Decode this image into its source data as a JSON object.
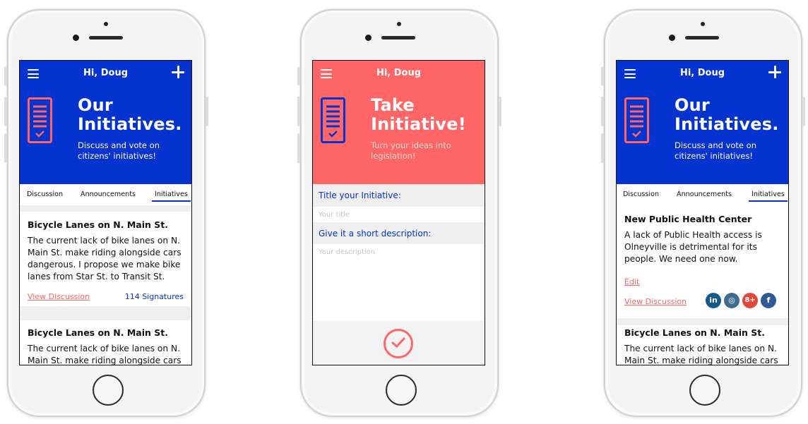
{
  "colors": {
    "brand_blue": "#0433cf",
    "coral": "#ff6665",
    "light_gray": "#efefef"
  },
  "screen1": {
    "greeting": "Hi, Doug",
    "hero_title_line1": "Our",
    "hero_title_line2": "Initiatives.",
    "hero_subtitle": "Discuss and vote on citizens' initiatives!",
    "tabs": [
      "Discussion",
      "Announcements",
      "Initiatives"
    ],
    "active_tab": "Initiatives",
    "cards": [
      {
        "title": "Bicycle Lanes on N. Main St.",
        "body": "The current lack of bike lanes on N. Main St. make riding alongside cars dangerous. I propose we make bike lanes from Star St. to Transit St.",
        "link": "View Discussion",
        "signatures": "114 Signatures"
      },
      {
        "title": "Bicycle Lanes on N. Main St.",
        "body": "The current lack of bike lanes on N. Main St. make riding alongside cars"
      }
    ]
  },
  "screen2": {
    "greeting": "Hi, Doug",
    "hero_title_line1": "Take",
    "hero_title_line2": "Initiative!",
    "hero_subtitle": "Turn your ideas into legislation!",
    "title_label": "Title your Initiative:",
    "title_placeholder": "Your title",
    "desc_label": "Give it a short description:",
    "desc_placeholder": "Your description"
  },
  "screen3": {
    "greeting": "Hi, Doug",
    "hero_title_line1": "Our",
    "hero_title_line2": "Initiatives.",
    "hero_subtitle": "Discuss and vote on citizens' initiatives!",
    "tabs": [
      "Discussion",
      "Announcements",
      "Initiatives"
    ],
    "active_tab": "Initiatives",
    "cards": [
      {
        "title": "New Public Health Center",
        "body": "A lack of Public Health access is Olneyville is detrimental for its people. We need one now.",
        "edit": "Edit",
        "link": "View Discussion",
        "social": [
          {
            "icon": "linkedin-icon",
            "glyph": "in",
            "color": "#155a8f"
          },
          {
            "icon": "instagram-icon",
            "glyph": "◎",
            "color": "#3f6b8f"
          },
          {
            "icon": "google-plus-icon",
            "glyph": "8+",
            "color": "#e5453b"
          },
          {
            "icon": "facebook-icon",
            "glyph": "f",
            "color": "#2f5a96"
          }
        ]
      },
      {
        "title": "Bicycle Lanes on N. Main St.",
        "body": "The current lack of bike lanes on N. Main St. make riding alongside cars"
      }
    ]
  }
}
